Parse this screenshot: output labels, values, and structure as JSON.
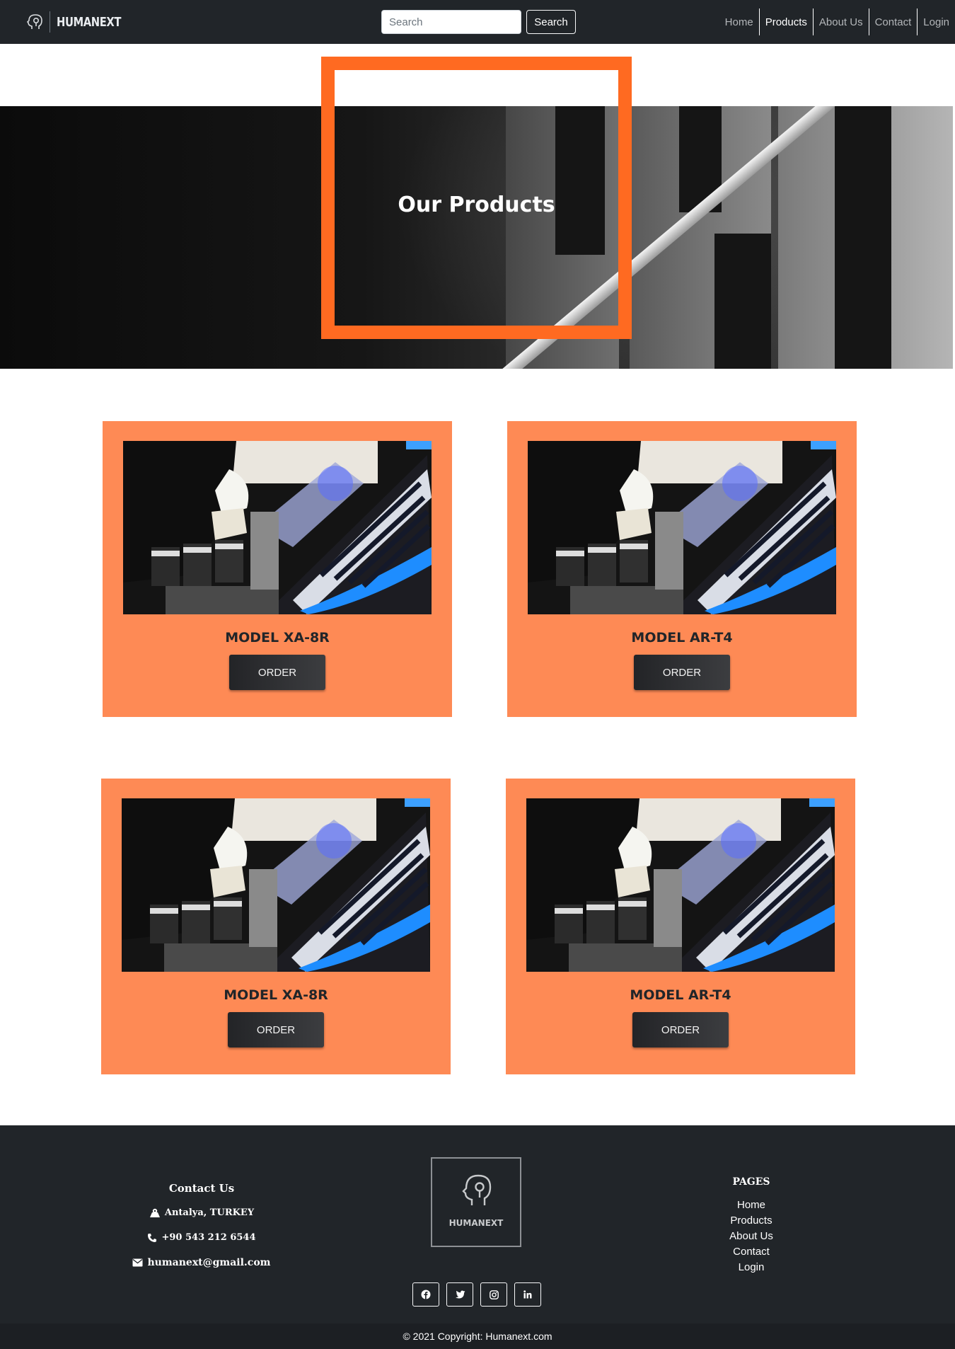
{
  "navbar": {
    "brand": "HUMANEXT",
    "search_placeholder": "Search",
    "search_button": "Search",
    "links": [
      "Home",
      "Products",
      "About Us",
      "Contact",
      "Login"
    ],
    "active_link": "Products"
  },
  "hero": {
    "title": "Our Products",
    "frame_color": "#ff6a21"
  },
  "products": [
    {
      "name": "MODEL XA-8R",
      "button": "ORDER"
    },
    {
      "name": "MODEL AR-T4",
      "button": "ORDER"
    },
    {
      "name": "MODEL XA-8R",
      "button": "ORDER"
    },
    {
      "name": "MODEL AR-T4",
      "button": "ORDER"
    }
  ],
  "card_color": "#fe8a55",
  "footer": {
    "contact_heading": "Contact Us",
    "address": "Antalya, TURKEY",
    "phone": "+90 543 212 6544",
    "email": "humanext@gmail.com",
    "logo_text": "HUMANEXT",
    "pages_heading": "PAGES",
    "pages": [
      "Home",
      "Products",
      "About Us",
      "Contact",
      "Login"
    ],
    "social": [
      "facebook-icon",
      "twitter-icon",
      "instagram-icon",
      "linkedin-icon"
    ],
    "copyright": "© 2021 Copyright: Humanext.com"
  }
}
